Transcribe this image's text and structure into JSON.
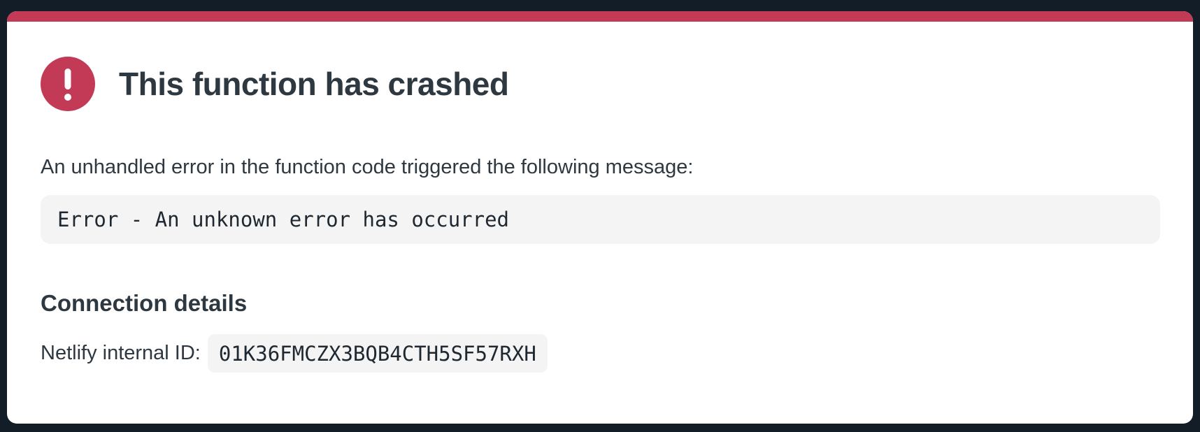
{
  "page": {
    "background_color": "#121d27",
    "card_color": "#ffffff",
    "accent_color": "#c33a57"
  },
  "header": {
    "icon": "exclamation-circle-icon",
    "title": "This function has crashed"
  },
  "message": {
    "description": "An unhandled error in the function code triggered the following message:",
    "error": "Error - An unknown error has occurred"
  },
  "connection": {
    "heading": "Connection details",
    "id_label": "Netlify internal ID:",
    "id_value": "01K36FMCZX3BQB4CTH5SF57RXH"
  }
}
